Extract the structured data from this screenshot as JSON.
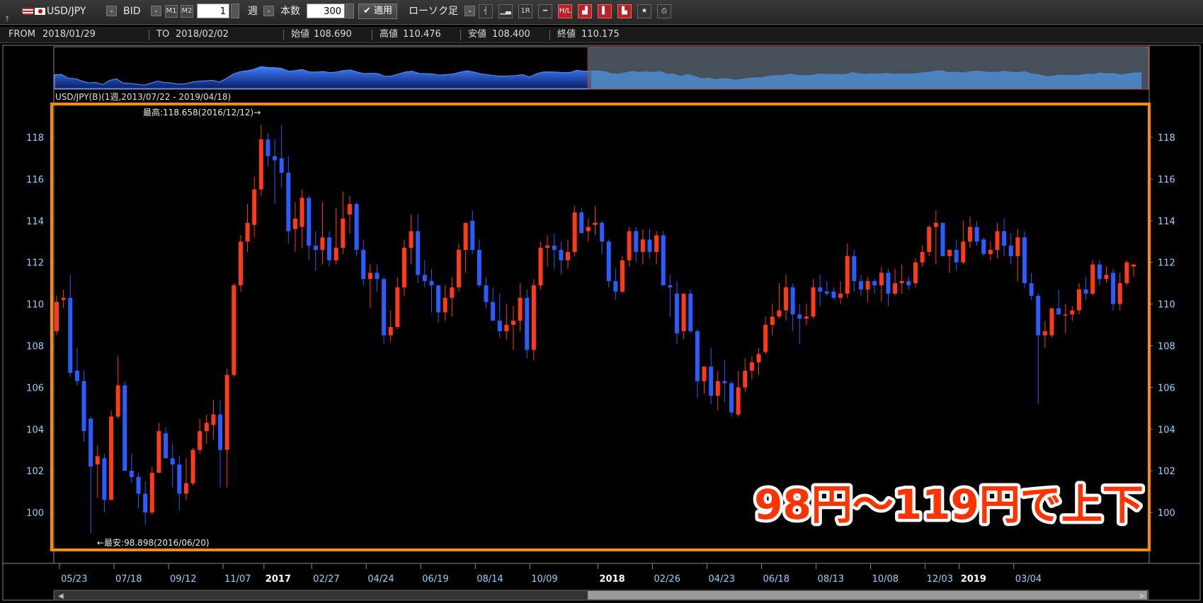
{
  "toolbar": {
    "symbol": "USD/JPY",
    "price_type": "BID",
    "m1": "M1",
    "m2": "M2",
    "period_value": "1",
    "period_unit": "週",
    "count_label": "本数",
    "count_value": "300",
    "apply_label": "✔ 適用",
    "chart_style": "ローソク足",
    "icons": [
      "candlestick-icon",
      "bar-chart-icon",
      "rsi-icon",
      "line-icon",
      "high-low-icon",
      "chart-red-icon",
      "bar-red-icon",
      "candle-red-icon",
      "star-icon",
      "print-icon"
    ]
  },
  "infobar": {
    "from_label": "FROM",
    "from_value": "2018/01/29",
    "to_label": "TO",
    "to_value": "2018/02/02",
    "open_label": "始値",
    "open_value": "108.690",
    "high_label": "高値",
    "high_value": "110.476",
    "low_label": "安値",
    "low_value": "108.400",
    "close_label": "終値",
    "close_value": "110.175"
  },
  "chart_title": "USD/JPY(B)(1週,2013/07/22 - 2019/04/18)",
  "max_annotation": "最高:118.658(2016/12/12)→",
  "min_annotation": "←最安:98.898(2016/06/20)",
  "overlay_text": "98円～119円で上下",
  "colors": {
    "up": "#ff3a1a",
    "down": "#2a5cff",
    "highlight": "#ff8a00",
    "axis": "#8fd4ff"
  },
  "chart_data": {
    "type": "candlestick",
    "y_ticks": [
      100,
      102,
      104,
      106,
      108,
      110,
      112,
      114,
      116,
      118
    ],
    "x_ticks": [
      "05/23",
      "07/18",
      "09/12",
      "11/07",
      "2017",
      "02/27",
      "04/24",
      "06/19",
      "08/14",
      "10/09",
      "2018",
      "02/26",
      "04/23",
      "06/18",
      "08/13",
      "10/08",
      "12/03",
      "2019",
      "03/04"
    ],
    "ylim": [
      98.2,
      119.6
    ],
    "candles": [
      [
        108.7,
        110.4,
        108.5,
        110.1
      ],
      [
        110.2,
        110.7,
        109.8,
        110.3
      ],
      [
        110.3,
        111.4,
        106.5,
        106.7
      ],
      [
        106.8,
        107.9,
        106.1,
        106.3
      ],
      [
        106.3,
        106.8,
        103.4,
        103.9
      ],
      [
        104.5,
        104.6,
        99.0,
        102.2
      ],
      [
        102.3,
        103.2,
        100.7,
        102.7
      ],
      [
        102.6,
        102.8,
        100.0,
        100.6
      ],
      [
        100.6,
        104.9,
        100.6,
        104.6
      ],
      [
        104.6,
        107.5,
        104.5,
        106.1
      ],
      [
        106.1,
        106.3,
        102.0,
        102.0
      ],
      [
        102.0,
        102.8,
        101.4,
        101.7
      ],
      [
        101.7,
        101.9,
        100.2,
        100.9
      ],
      [
        100.9,
        101.5,
        99.4,
        100.0
      ],
      [
        100.0,
        102.2,
        99.9,
        101.9
      ],
      [
        101.9,
        104.3,
        101.9,
        103.9
      ],
      [
        103.8,
        104.1,
        102.6,
        102.6
      ],
      [
        102.6,
        103.3,
        101.2,
        102.3
      ],
      [
        102.3,
        102.7,
        100.1,
        100.9
      ],
      [
        100.9,
        102.6,
        100.6,
        101.4
      ],
      [
        101.4,
        103.1,
        101.3,
        103.0
      ],
      [
        103.0,
        104.5,
        102.8,
        103.9
      ],
      [
        103.9,
        104.7,
        103.3,
        104.3
      ],
      [
        104.2,
        105.4,
        103.5,
        104.7
      ],
      [
        104.7,
        105.4,
        101.2,
        103.0
      ],
      [
        103.0,
        106.9,
        101.2,
        106.6
      ],
      [
        106.6,
        111.0,
        106.5,
        110.9
      ],
      [
        110.9,
        113.3,
        110.6,
        113.0
      ],
      [
        113.0,
        114.8,
        112.5,
        113.9
      ],
      [
        113.8,
        116.1,
        113.2,
        115.5
      ],
      [
        115.5,
        118.6,
        115.2,
        117.9
      ],
      [
        117.9,
        118.2,
        116.6,
        117.1
      ],
      [
        117.1,
        117.9,
        114.8,
        116.9
      ],
      [
        117.0,
        118.6,
        115.6,
        116.3
      ],
      [
        116.3,
        117.1,
        112.9,
        113.5
      ],
      [
        113.6,
        114.9,
        112.5,
        114.1
      ],
      [
        113.7,
        115.5,
        112.7,
        115.1
      ],
      [
        115.1,
        115.2,
        112.1,
        112.8
      ],
      [
        112.8,
        113.5,
        111.6,
        112.6
      ],
      [
        112.6,
        114.9,
        111.9,
        113.2
      ],
      [
        113.2,
        113.5,
        111.8,
        112.1
      ],
      [
        112.1,
        114.6,
        111.9,
        112.7
      ],
      [
        112.7,
        115.4,
        112.4,
        114.1
      ],
      [
        114.3,
        115.2,
        113.4,
        114.8
      ],
      [
        114.8,
        114.9,
        112.3,
        112.6
      ],
      [
        112.6,
        113.1,
        110.9,
        111.2
      ],
      [
        111.2,
        111.9,
        109.8,
        111.5
      ],
      [
        111.5,
        111.9,
        110.6,
        111.2
      ],
      [
        111.2,
        111.3,
        108.1,
        108.5
      ],
      [
        108.5,
        109.7,
        108.2,
        108.9
      ],
      [
        108.9,
        111.3,
        108.8,
        110.8
      ],
      [
        110.8,
        113.1,
        110.4,
        112.7
      ],
      [
        112.7,
        114.3,
        111.9,
        113.5
      ],
      [
        113.5,
        114.3,
        111.0,
        111.4
      ],
      [
        111.4,
        112.1,
        110.8,
        111.1
      ],
      [
        111.1,
        111.7,
        109.6,
        110.9
      ],
      [
        110.9,
        110.9,
        109.1,
        109.6
      ],
      [
        109.6,
        110.9,
        109.2,
        110.3
      ],
      [
        110.3,
        111.3,
        109.4,
        110.8
      ],
      [
        110.8,
        112.9,
        110.6,
        112.6
      ],
      [
        112.6,
        113.8,
        111.5,
        113.9
      ],
      [
        114.0,
        114.5,
        112.4,
        112.6
      ],
      [
        112.6,
        113.1,
        110.8,
        110.9
      ],
      [
        110.9,
        111.3,
        109.8,
        110.1
      ],
      [
        110.1,
        110.8,
        109.3,
        109.2
      ],
      [
        109.2,
        110.5,
        108.4,
        108.7
      ],
      [
        108.7,
        110.0,
        108.3,
        109.0
      ],
      [
        109.0,
        109.9,
        107.8,
        109.2
      ],
      [
        109.2,
        111.0,
        108.7,
        110.3
      ],
      [
        110.3,
        110.7,
        107.4,
        107.8
      ],
      [
        107.8,
        111.2,
        107.3,
        110.9
      ],
      [
        110.9,
        113.0,
        110.7,
        112.7
      ],
      [
        112.7,
        113.3,
        111.8,
        112.8
      ],
      [
        112.8,
        113.4,
        111.7,
        112.6
      ],
      [
        112.6,
        113.0,
        111.4,
        112.1
      ],
      [
        112.1,
        113.1,
        111.7,
        112.5
      ],
      [
        112.5,
        114.7,
        112.3,
        114.4
      ],
      [
        114.4,
        114.6,
        113.4,
        113.4
      ],
      [
        113.5,
        114.1,
        113.0,
        113.7
      ],
      [
        113.8,
        114.7,
        113.3,
        113.9
      ],
      [
        113.9,
        114.0,
        112.4,
        113.0
      ],
      [
        113.0,
        113.1,
        110.8,
        111.1
      ],
      [
        111.1,
        111.7,
        110.2,
        110.6
      ],
      [
        110.6,
        112.3,
        110.5,
        112.1
      ],
      [
        112.1,
        113.7,
        111.8,
        113.5
      ],
      [
        113.5,
        113.7,
        112.0,
        112.5
      ],
      [
        112.5,
        113.6,
        111.9,
        113.1
      ],
      [
        113.1,
        113.6,
        112.2,
        112.5
      ],
      [
        112.5,
        113.5,
        111.9,
        113.3
      ],
      [
        113.3,
        113.5,
        110.9,
        110.9
      ],
      [
        110.9,
        111.4,
        109.4,
        110.8
      ],
      [
        110.5,
        111.1,
        108.1,
        108.6
      ],
      [
        108.7,
        109.6,
        108.3,
        110.5
      ],
      [
        110.5,
        110.7,
        108.6,
        108.7
      ],
      [
        108.7,
        108.8,
        105.5,
        106.3
      ],
      [
        106.3,
        107.0,
        105.7,
        107.0
      ],
      [
        107.0,
        107.9,
        105.2,
        105.6
      ],
      [
        105.6,
        106.8,
        104.9,
        106.3
      ],
      [
        106.3,
        107.3,
        105.3,
        106.2
      ],
      [
        106.2,
        106.3,
        104.6,
        104.8
      ],
      [
        104.7,
        106.8,
        104.6,
        106.0
      ],
      [
        106.0,
        107.4,
        105.8,
        106.8
      ],
      [
        106.8,
        107.5,
        106.4,
        107.2
      ],
      [
        107.2,
        107.9,
        106.6,
        107.6
      ],
      [
        107.7,
        109.4,
        107.6,
        109.0
      ],
      [
        109.0,
        110.0,
        108.5,
        109.4
      ],
      [
        109.4,
        111.0,
        109.3,
        109.7
      ],
      [
        109.7,
        111.4,
        109.2,
        110.8
      ],
      [
        110.8,
        111.0,
        108.7,
        109.5
      ],
      [
        109.5,
        110.0,
        108.1,
        109.3
      ],
      [
        109.3,
        110.0,
        109.0,
        109.4
      ],
      [
        109.4,
        111.2,
        109.3,
        110.8
      ],
      [
        110.8,
        111.4,
        109.9,
        110.6
      ],
      [
        110.6,
        111.1,
        110.4,
        110.5
      ],
      [
        110.6,
        110.8,
        110.2,
        110.3
      ],
      [
        110.3,
        111.1,
        110.0,
        110.5
      ],
      [
        110.5,
        112.9,
        110.3,
        112.3
      ],
      [
        112.3,
        112.6,
        110.6,
        111.1
      ],
      [
        111.1,
        111.4,
        110.4,
        110.7
      ],
      [
        110.7,
        111.3,
        110.1,
        111.1
      ],
      [
        111.1,
        111.2,
        110.5,
        110.9
      ],
      [
        110.9,
        111.8,
        110.1,
        111.5
      ],
      [
        111.5,
        111.7,
        109.9,
        110.5
      ],
      [
        110.5,
        111.7,
        110.4,
        111.0
      ],
      [
        111.0,
        111.9,
        110.5,
        111.1
      ],
      [
        111.1,
        111.3,
        110.7,
        110.9
      ],
      [
        111.0,
        112.2,
        110.8,
        112.0
      ],
      [
        112.0,
        112.8,
        111.8,
        112.5
      ],
      [
        112.5,
        113.8,
        112.3,
        113.7
      ],
      [
        113.7,
        114.5,
        111.9,
        113.9
      ],
      [
        113.9,
        113.9,
        112.3,
        112.3
      ],
      [
        112.3,
        112.5,
        111.5,
        112.6
      ],
      [
        112.6,
        113.1,
        111.6,
        112.0
      ],
      [
        112.0,
        114.0,
        111.9,
        113.0
      ],
      [
        113.0,
        114.2,
        112.7,
        113.7
      ],
      [
        113.7,
        114.0,
        112.8,
        113.0
      ],
      [
        113.1,
        113.2,
        112.3,
        112.4
      ],
      [
        112.4,
        113.0,
        112.1,
        112.6
      ],
      [
        112.6,
        113.9,
        112.2,
        113.5
      ],
      [
        113.5,
        114.1,
        112.3,
        112.8
      ],
      [
        112.8,
        113.4,
        111.9,
        112.3
      ],
      [
        112.3,
        113.6,
        111.1,
        113.2
      ],
      [
        113.2,
        113.5,
        110.8,
        111.0
      ],
      [
        111.0,
        111.5,
        110.2,
        110.4
      ],
      [
        110.4,
        110.5,
        105.2,
        108.5
      ],
      [
        108.5,
        109.2,
        107.9,
        108.7
      ],
      [
        108.5,
        109.8,
        108.4,
        109.8
      ],
      [
        109.8,
        110.7,
        109.6,
        109.5
      ],
      [
        109.5,
        110.0,
        108.6,
        109.5
      ],
      [
        109.5,
        109.9,
        109.2,
        109.7
      ],
      [
        109.7,
        111.0,
        109.5,
        110.7
      ],
      [
        110.7,
        111.3,
        110.2,
        110.5
      ],
      [
        110.5,
        112.1,
        110.4,
        111.9
      ],
      [
        111.9,
        112.1,
        110.9,
        111.2
      ],
      [
        111.2,
        111.8,
        111.0,
        111.4
      ],
      [
        111.5,
        111.7,
        109.7,
        110.0
      ],
      [
        110.0,
        111.5,
        109.7,
        111.0
      ],
      [
        111.0,
        112.1,
        110.9,
        112.0
      ],
      [
        111.8,
        111.9,
        111.3,
        111.9
      ]
    ]
  }
}
